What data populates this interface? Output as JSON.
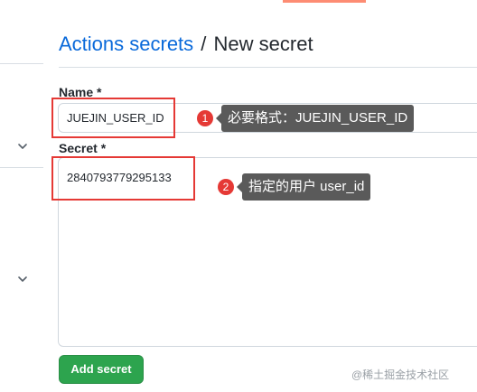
{
  "header": {
    "breadcrumb_link": "Actions secrets",
    "separator": "/",
    "current": "New secret"
  },
  "form": {
    "name_label": "Name *",
    "name_value": "JUEJIN_USER_ID",
    "secret_label": "Secret *",
    "secret_value": "2840793779295133",
    "submit_label": "Add secret"
  },
  "annotations": [
    {
      "number": "1",
      "text": "必要格式：JUEJIN_USER_ID"
    },
    {
      "number": "2",
      "text": "指定的用户 user_id"
    }
  ],
  "watermark": "@稀土掘金技术社区",
  "icons": {
    "sidebar_toggle_1": "chevron-down-icon",
    "sidebar_toggle_2": "chevron-down-icon"
  },
  "colors": {
    "link": "#0969da",
    "primary_button": "#2da44e",
    "highlight": "#e53935",
    "tooltip": "#5a5a5a",
    "tab_accent": "#fd8c73"
  }
}
